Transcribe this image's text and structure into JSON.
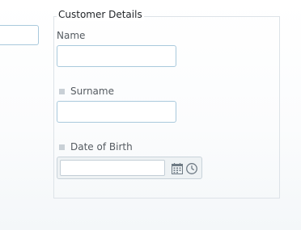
{
  "fieldset": {
    "legend": "Customer Details"
  },
  "fields": {
    "name": {
      "label": "Name",
      "value": ""
    },
    "surname": {
      "label": "Surname",
      "value": ""
    },
    "dob": {
      "label": "Date of Birth",
      "value": ""
    }
  },
  "icons": {
    "calendar": "calendar-icon",
    "clock": "clock-icon"
  },
  "colors": {
    "input_border": "#a9c9dc",
    "fieldset_border": "#dde3e8",
    "icon": "#6e7a84",
    "required_marker": "#c9d0d6"
  }
}
